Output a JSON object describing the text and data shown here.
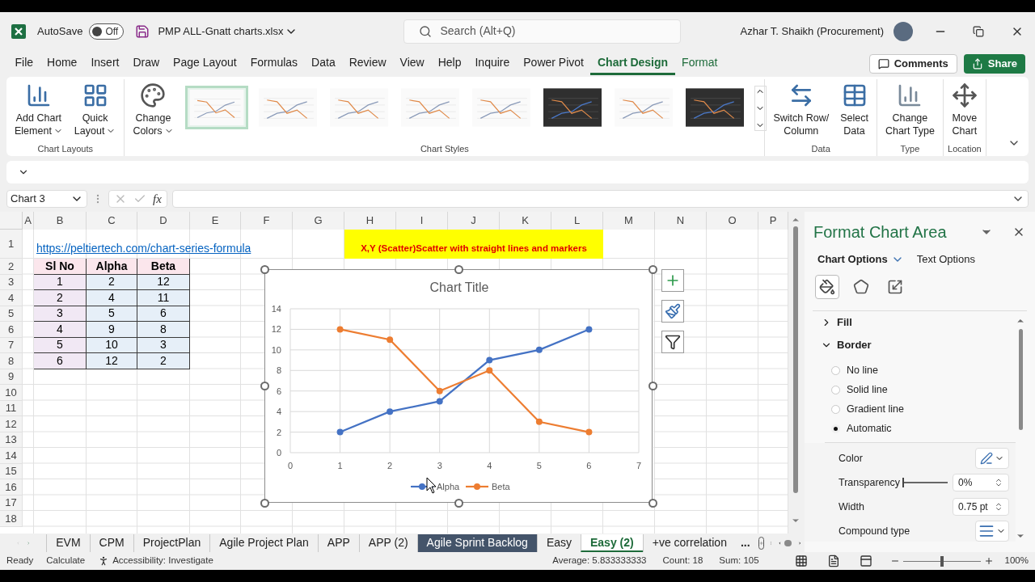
{
  "title_bar": {
    "autosave_label": "AutoSave",
    "autosave": {
      "on": false,
      "label": "Off"
    },
    "file_name": "PMP ALL-Gnatt charts.xlsx",
    "search_placeholder": "Search (Alt+Q)",
    "user_name": "Azhar T. Shaikh (Procurement)"
  },
  "menu_tabs": [
    {
      "label": "File",
      "kind": "standard",
      "selected": false
    },
    {
      "label": "Home",
      "kind": "standard",
      "selected": false
    },
    {
      "label": "Insert",
      "kind": "standard",
      "selected": false
    },
    {
      "label": "Draw",
      "kind": "standard",
      "selected": false
    },
    {
      "label": "Page Layout",
      "kind": "standard",
      "selected": false
    },
    {
      "label": "Formulas",
      "kind": "standard",
      "selected": false
    },
    {
      "label": "Data",
      "kind": "standard",
      "selected": false
    },
    {
      "label": "Review",
      "kind": "standard",
      "selected": false
    },
    {
      "label": "View",
      "kind": "standard",
      "selected": false
    },
    {
      "label": "Help",
      "kind": "standard",
      "selected": false
    },
    {
      "label": "Inquire",
      "kind": "standard",
      "selected": false
    },
    {
      "label": "Power Pivot",
      "kind": "standard",
      "selected": false
    },
    {
      "label": "Chart Design",
      "kind": "contextual",
      "selected": true
    },
    {
      "label": "Format",
      "kind": "contextual",
      "selected": false
    }
  ],
  "header_buttons": {
    "comments": "Comments",
    "share": "Share"
  },
  "ribbon": {
    "groups": [
      {
        "label": "Chart Layouts",
        "kind": "buttons",
        "buttons": [
          {
            "kind": "add_element",
            "lines": [
              "Add Chart",
              "Element"
            ],
            "dropdown": true
          },
          {
            "kind": "quick_layout",
            "lines": [
              "Quick",
              "Layout"
            ],
            "dropdown": true
          }
        ]
      },
      {
        "label": "Chart Styles",
        "kind": "gallery",
        "buttons": [
          {
            "kind": "change_colors",
            "lines": [
              "Change",
              "Colors"
            ],
            "dropdown": true
          }
        ],
        "styles": [
          {
            "kind": "light",
            "selected": true
          },
          {
            "kind": "light",
            "selected": false
          },
          {
            "kind": "light",
            "selected": false
          },
          {
            "kind": "light",
            "selected": false
          },
          {
            "kind": "light",
            "selected": false
          },
          {
            "kind": "dark",
            "selected": false
          },
          {
            "kind": "light",
            "selected": false
          },
          {
            "kind": "dark",
            "selected": false
          }
        ]
      },
      {
        "label": "Data",
        "kind": "buttons",
        "buttons": [
          {
            "kind": "switch",
            "lines": [
              "Switch Row/",
              "Column"
            ],
            "dropdown": false
          },
          {
            "kind": "select_data",
            "lines": [
              "Select",
              "Data"
            ],
            "dropdown": false
          }
        ]
      },
      {
        "label": "Type",
        "kind": "buttons",
        "buttons": [
          {
            "kind": "change_type",
            "lines": [
              "Change",
              "Chart Type"
            ],
            "dropdown": false
          }
        ]
      },
      {
        "label": "Location",
        "kind": "buttons",
        "buttons": [
          {
            "kind": "move_chart",
            "lines": [
              "Move",
              "Chart"
            ],
            "dropdown": false
          }
        ]
      }
    ]
  },
  "formula_bar": {
    "name_box": "Chart 3",
    "fx_label": "fx"
  },
  "sheet": {
    "columns": [
      "A",
      "B",
      "C",
      "D",
      "E",
      "F",
      "G",
      "H",
      "I",
      "J",
      "K",
      "L",
      "M",
      "N",
      "O",
      "P"
    ],
    "rows": [
      "1",
      "2",
      "3",
      "4",
      "5",
      "6",
      "7",
      "8",
      "9",
      "10",
      "11",
      "12",
      "13",
      "14",
      "15",
      "16",
      "17",
      "18"
    ],
    "link": "https://peltiertech.com/chart-series-formula",
    "banner": "X,Y (Scatter)Scatter with straight lines and markers",
    "table": {
      "columns": [
        "Sl No",
        "Alpha",
        "Beta"
      ],
      "rows": [
        [
          "1",
          "2",
          "12"
        ],
        [
          "2",
          "4",
          "11"
        ],
        [
          "3",
          "5",
          "6"
        ],
        [
          "4",
          "9",
          "8"
        ],
        [
          "5",
          "10",
          "3"
        ],
        [
          "6",
          "12",
          "2"
        ]
      ]
    }
  },
  "chart": {
    "selected": true,
    "chart_data": {
      "type": "line",
      "title": "Chart Title",
      "x": [
        1,
        2,
        3,
        4,
        5,
        6
      ],
      "grid": true,
      "legend": "bottom",
      "series": [
        {
          "name": "Alpha",
          "color": "#4472c4",
          "marker": "circle",
          "values": [
            2,
            4,
            5,
            9,
            10,
            12
          ]
        },
        {
          "name": "Beta",
          "color": "#ed7d31",
          "marker": "circle",
          "values": [
            12,
            11,
            6,
            8,
            3,
            2
          ]
        }
      ],
      "xlim": [
        0,
        7
      ],
      "ylim": [
        0,
        14
      ],
      "xticks": [
        0,
        1,
        2,
        3,
        4,
        5,
        6,
        7
      ],
      "yticks": [
        0,
        2,
        4,
        6,
        8,
        10,
        12,
        14
      ]
    }
  },
  "format_pane": {
    "title": "Format Chart Area",
    "tabs": [
      {
        "label": "Chart Options",
        "selected": true
      },
      {
        "label": "Text Options",
        "selected": false
      }
    ],
    "sections": [
      {
        "label": "Fill",
        "expanded": false
      },
      {
        "label": "Border",
        "expanded": true
      }
    ],
    "border_options": [
      {
        "label": "No line",
        "selected": false
      },
      {
        "label": "Solid line",
        "selected": false
      },
      {
        "label": "Gradient line",
        "selected": false
      },
      {
        "label": "Automatic",
        "selected": true
      }
    ],
    "properties": [
      {
        "label": "Color",
        "kind": "color"
      },
      {
        "label": "Transparency",
        "kind": "slider",
        "value": "0%",
        "level": 0
      },
      {
        "label": "Width",
        "kind": "spin",
        "value": "0.75 pt"
      },
      {
        "label": "Compound type",
        "kind": "lines"
      }
    ]
  },
  "sheet_tabs": [
    {
      "label": "EVM",
      "selected": false
    },
    {
      "label": "CPM",
      "selected": false
    },
    {
      "label": "ProjectPlan",
      "selected": false
    },
    {
      "label": "Agile Project Plan",
      "selected": false
    },
    {
      "label": "APP",
      "selected": false
    },
    {
      "label": "APP (2)",
      "selected": false
    },
    {
      "label": "Agile Sprint Backlog",
      "selected": false,
      "color": "#44546a"
    },
    {
      "label": "Easy",
      "selected": false
    },
    {
      "label": "Easy (2)",
      "selected": true
    },
    {
      "label": "+ve correlation",
      "selected": false
    }
  ],
  "more_tabs": "...",
  "status_bar": {
    "left": [
      "Ready",
      "Calculate"
    ],
    "accessibility": "Accessibility: Investigate",
    "stats": [
      "Average: 5.833333333",
      "Count: 18",
      "Sum: 105"
    ],
    "zoom": {
      "label": "100%",
      "level": 0.5
    }
  }
}
